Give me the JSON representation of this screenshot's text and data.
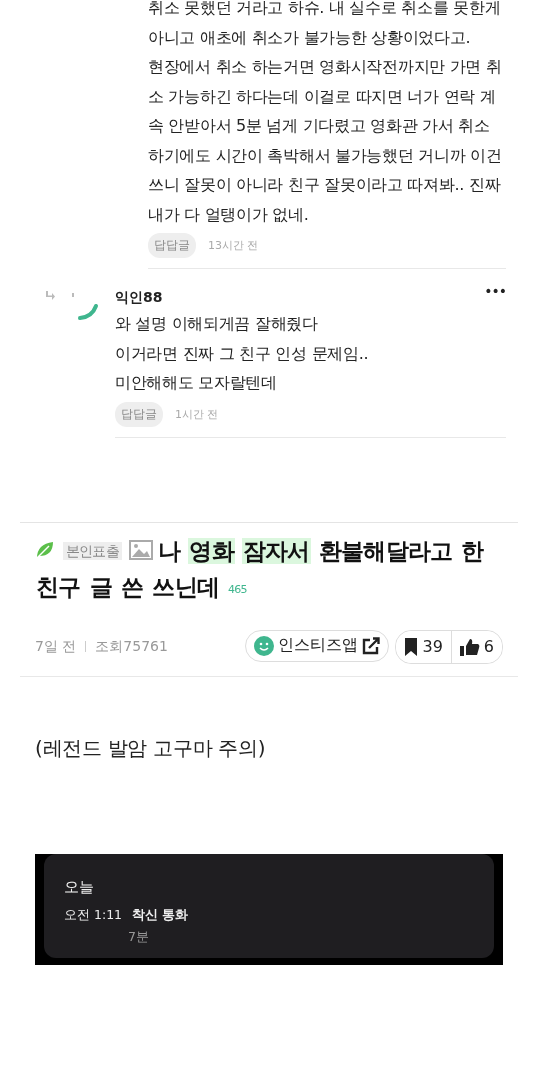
{
  "comments": [
    {
      "reply": false,
      "text": "취소 못했던 거라고 하슈. 내 실수로 취소를 못한게\n아니고 애초에 취소가 불가능한 상황이었다고.\n현장에서 취소 하는거면 영화시작전까지만 가면 취\n소 가능하긴 하다는데 이걸로 따지면 너가 연락 계\n속 안받아서 5분 넘게 기다렸고 영화관 가서 취소\n하기에도 시간이 촉박해서 불가능했던 거니까 이건\n쓰니 잘못이 아니라 친구 잘못이라고 따져봐.. 진짜\n내가 다 얼탱이가 없네.",
      "tag": "답답글",
      "time": "13시간 전"
    },
    {
      "author": "익인88",
      "reply": true,
      "more": "•••",
      "text": "와 설명 이해되게끔 잘해줬다\n이거라면 진짜 그 친구 인성 문제임..\n미안해해도 모자랄텐데",
      "tag": "답답글",
      "time": "1시간 전"
    }
  ],
  "post": {
    "badge": "본인표출",
    "title": [
      {
        "text": "나",
        "highlight": false
      },
      {
        "text": "영화",
        "highlight": true
      },
      {
        "text": "잠자서",
        "highlight": true
      },
      {
        "text": "환불해달라고",
        "highlight": false
      },
      {
        "text": "한",
        "highlight": false
      },
      {
        "text": "친구",
        "highlight": false
      },
      {
        "text": "글",
        "highlight": false
      },
      {
        "text": "쓴",
        "highlight": false
      },
      {
        "text": "쓰닌데",
        "highlight": false
      }
    ],
    "comment_count": "465",
    "date": "7일 전",
    "views": "조회75761",
    "app_button": "인스티즈앱",
    "bookmarks": "39",
    "likes": "6",
    "body_text": "(레전드 발암 고구마 주의)",
    "call_log": {
      "heading": "오늘",
      "time": "오전 1:11",
      "call_type": "착신 통화",
      "duration": "7분"
    }
  }
}
